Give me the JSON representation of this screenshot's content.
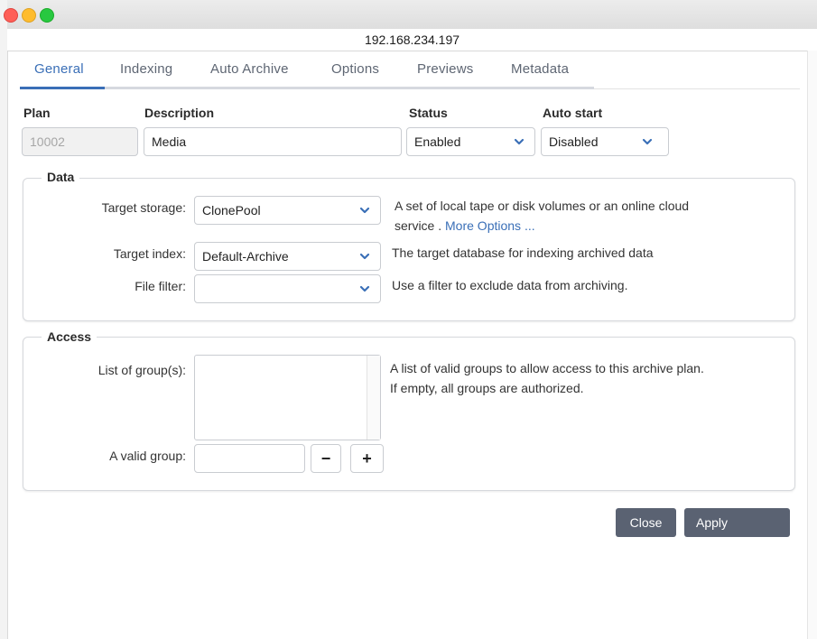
{
  "window": {
    "address": "192.168.234.197"
  },
  "tabs": [
    "General",
    "Indexing",
    "Auto Archive",
    "Options",
    "Previews",
    "Metadata"
  ],
  "active_tab": "General",
  "header": {
    "plan_label": "Plan",
    "plan_value": "10002",
    "description_label": "Description",
    "description_value": "Media",
    "status_label": "Status",
    "status_value": "Enabled",
    "autostart_label": "Auto start",
    "autostart_value": "Disabled"
  },
  "data_group": {
    "title": "Data",
    "target_storage_label": "Target storage:",
    "target_storage_value": "ClonePool",
    "target_storage_help": "A set of local tape or disk volumes or an online cloud",
    "target_storage_help2": "service .",
    "more_options": "More Options ...",
    "target_index_label": "Target index:",
    "target_index_value": "Default-Archive",
    "target_index_help": "The target database for indexing archived data",
    "file_filter_label": "File filter:",
    "file_filter_value": "",
    "file_filter_help": "Use a filter to exclude data from archiving."
  },
  "access_group": {
    "title": "Access",
    "groups_label": "List of group(s):",
    "groups_help1": "A list of valid groups to allow access to this archive plan.",
    "groups_help2": "If empty, all groups are authorized.",
    "valid_group_label": "A valid group:",
    "valid_group_value": "",
    "minus_label": "−",
    "plus_label": "+"
  },
  "buttons": {
    "close": "Close",
    "apply": "Apply"
  },
  "colors": {
    "accent": "#3a6fb7",
    "button": "#5a6272"
  },
  "icons": {
    "dropdown": "chevron-down-icon"
  }
}
